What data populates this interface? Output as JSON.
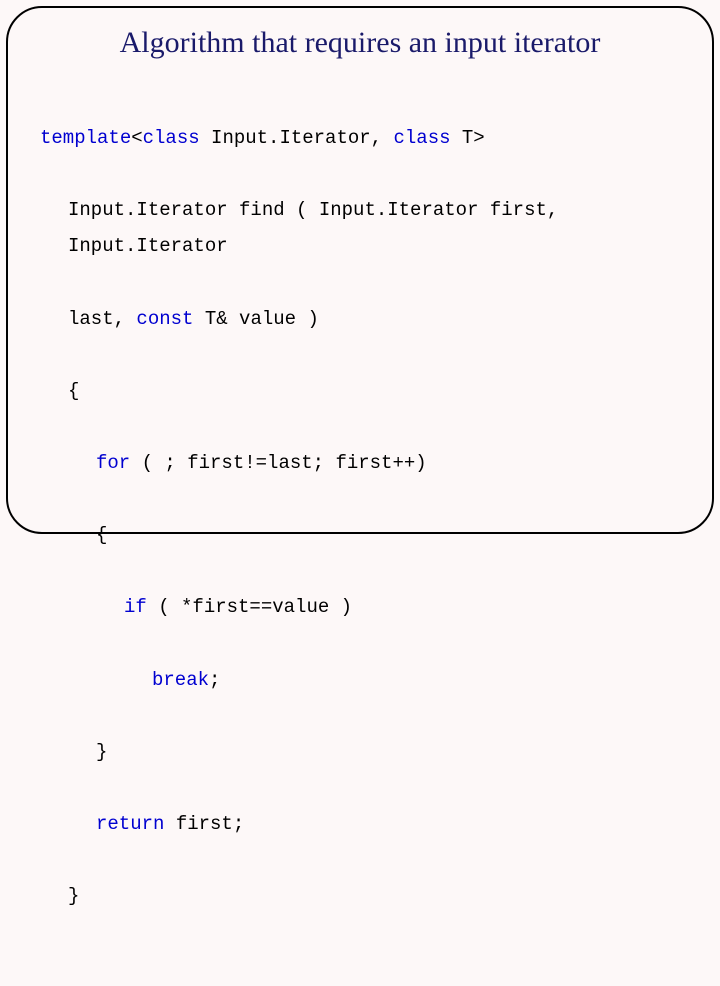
{
  "title": "Algorithm that requires an input iterator",
  "code": {
    "l1a": "template",
    "l1b": "<",
    "l1c": "class",
    "l1d": " Input.Iterator, ",
    "l1e": "class",
    "l1f": " T>",
    "l2": "Input.Iterator find ( Input.Iterator first, Input.Iterator",
    "l3a": "last, ",
    "l3b": "const",
    "l3c": " T& value )",
    "l4": "{",
    "l5a": "for",
    "l5b": " ( ; first!=last; first++)",
    "l6": "{",
    "l7a": "if",
    "l7b": " ( *first==value )",
    "l8": "break",
    "l8b": ";",
    "l9": "}",
    "l10a": "return",
    "l10b": " first;",
    "l11": "}"
  }
}
